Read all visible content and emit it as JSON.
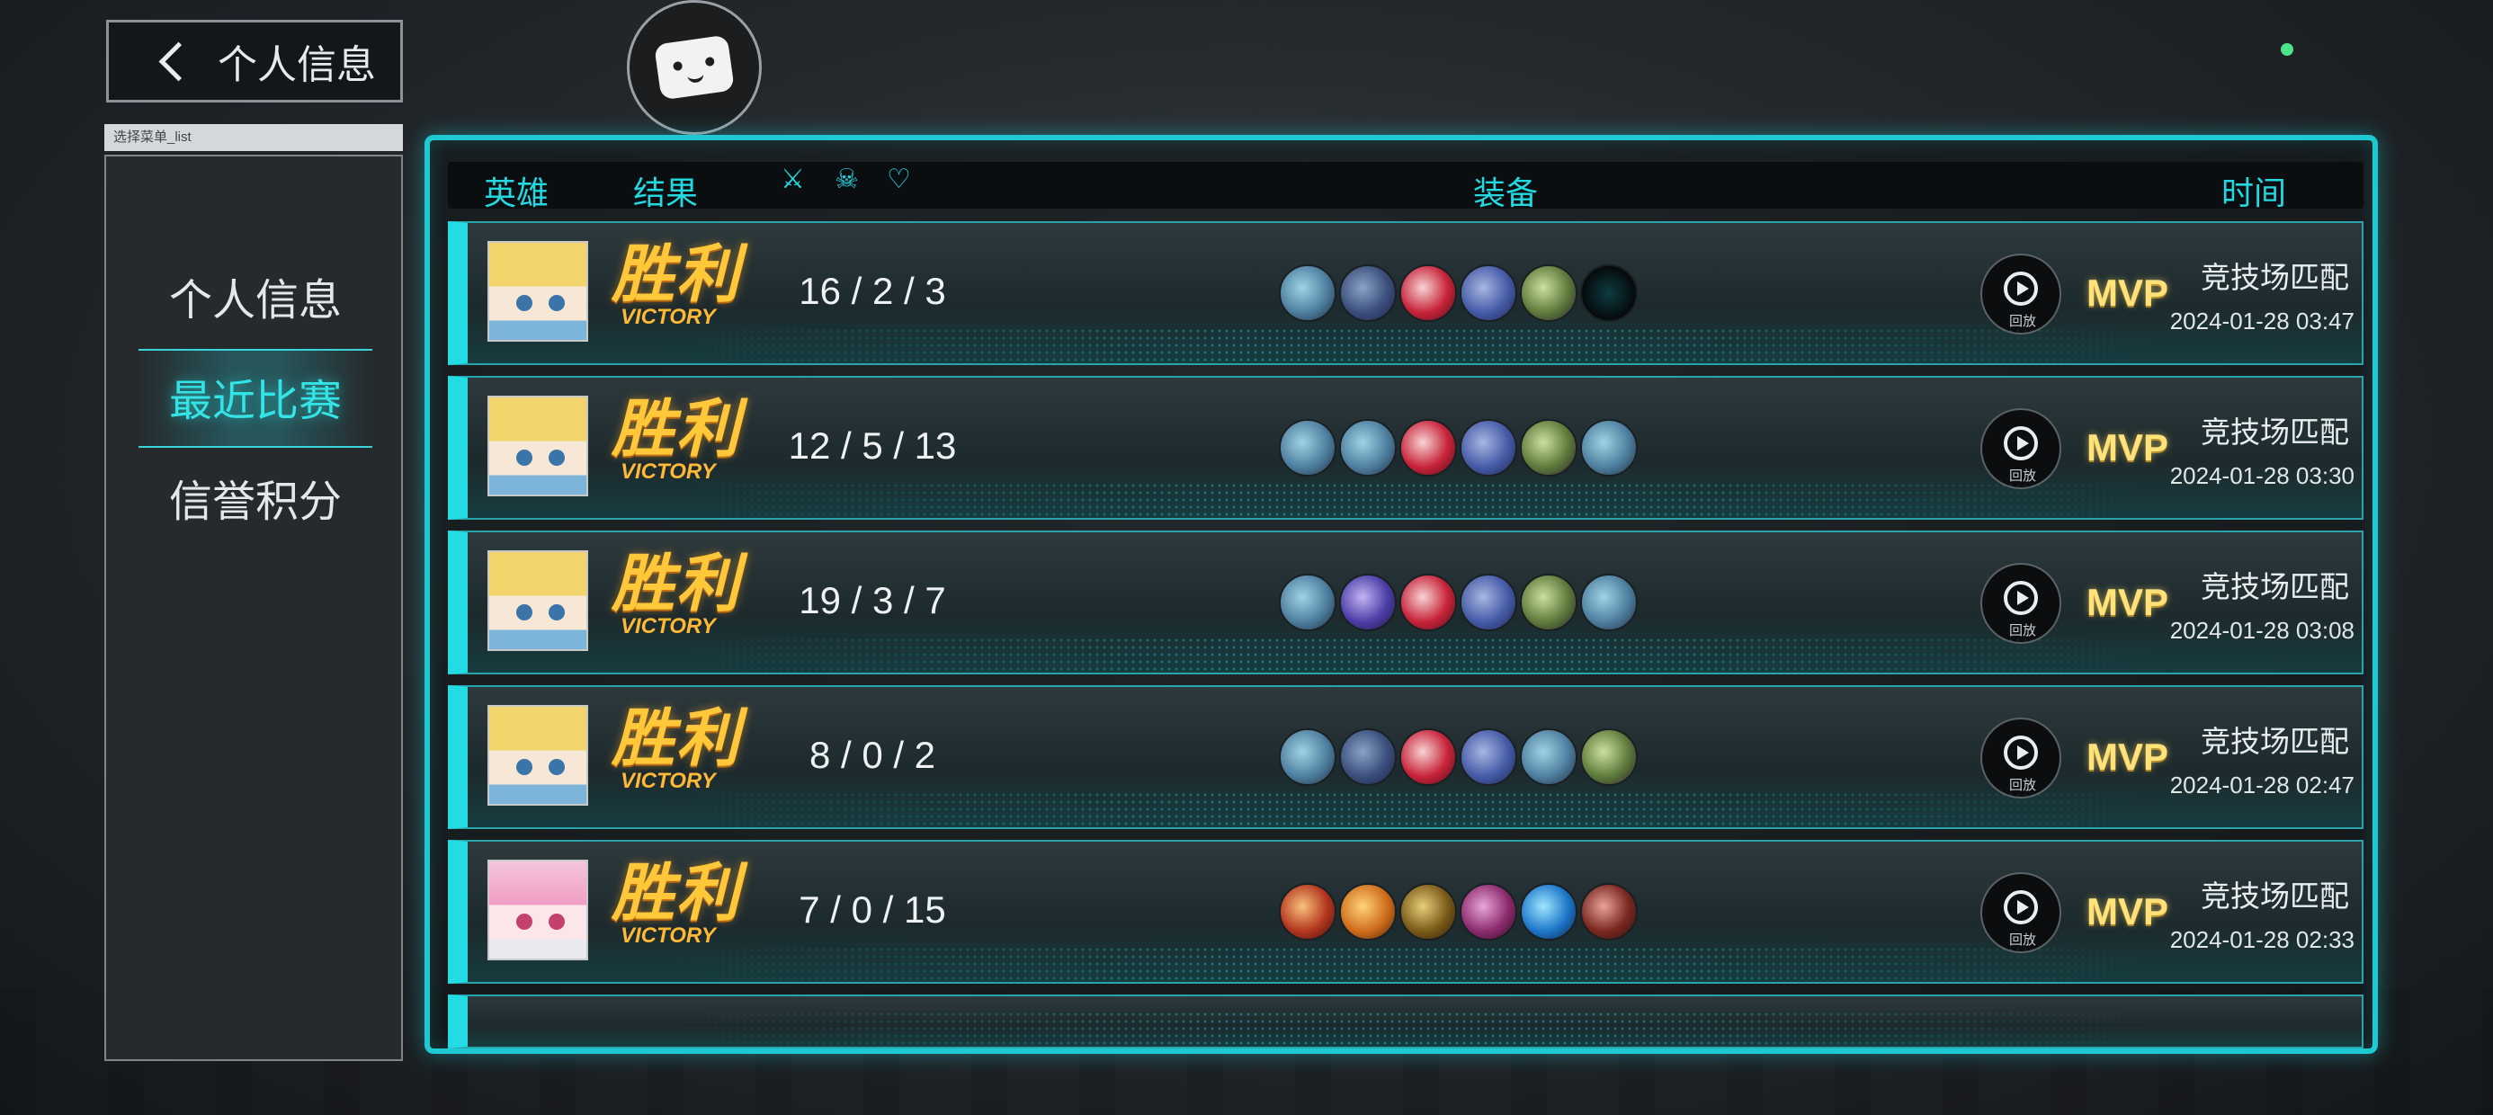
{
  "back_button": {
    "label": "个人信息"
  },
  "sidebar": {
    "tag": "选择菜单_list",
    "items": [
      {
        "label": "个人信息",
        "active": false
      },
      {
        "label": "最近比赛",
        "active": true
      },
      {
        "label": "信誉积分",
        "active": false
      }
    ]
  },
  "table": {
    "headers": {
      "hero": "英雄",
      "result": "结果",
      "equipment": "装备",
      "time": "时间"
    },
    "header_icons": [
      "sword-icon",
      "skull-icon",
      "handshake-icon"
    ],
    "replay_label": "回放",
    "rows": [
      {
        "hero": "blonde",
        "result": "胜利",
        "result_en": "VICTORY",
        "kda": "16 / 2 / 3",
        "items": [
          "blue",
          "navy",
          "red",
          "slate",
          "green",
          "empty"
        ],
        "badge": "MVP",
        "mode": "竞技场匹配",
        "time": "2024-01-28 03:47"
      },
      {
        "hero": "blonde",
        "result": "胜利",
        "result_en": "VICTORY",
        "kda": "12 / 5 / 13",
        "items": [
          "blue",
          "blue",
          "red",
          "slate",
          "green",
          "blue"
        ],
        "badge": "MVP",
        "mode": "竞技场匹配",
        "time": "2024-01-28 03:30"
      },
      {
        "hero": "blonde",
        "result": "胜利",
        "result_en": "VICTORY",
        "kda": "19 / 3 / 7",
        "items": [
          "blue",
          "violet",
          "red",
          "slate",
          "green",
          "blue"
        ],
        "badge": "MVP",
        "mode": "竞技场匹配",
        "time": "2024-01-28 03:08"
      },
      {
        "hero": "blonde",
        "result": "胜利",
        "result_en": "VICTORY",
        "kda": "8 / 0 / 2",
        "items": [
          "blue",
          "navy",
          "red",
          "slate",
          "blue",
          "green"
        ],
        "badge": "MVP",
        "mode": "竞技场匹配",
        "time": "2024-01-28 02:47"
      },
      {
        "hero": "pink",
        "result": "胜利",
        "result_en": "VICTORY",
        "kda": "7 / 0 / 15",
        "items": [
          "fire",
          "orange",
          "gold",
          "purple",
          "azure",
          "maroon"
        ],
        "badge": "MVP",
        "mode": "竞技场匹配",
        "time": "2024-01-28 02:33"
      }
    ]
  },
  "colors": {
    "accent": "#22dbe3",
    "victory": "#ffc83b",
    "mvp": "#ffe27a"
  }
}
